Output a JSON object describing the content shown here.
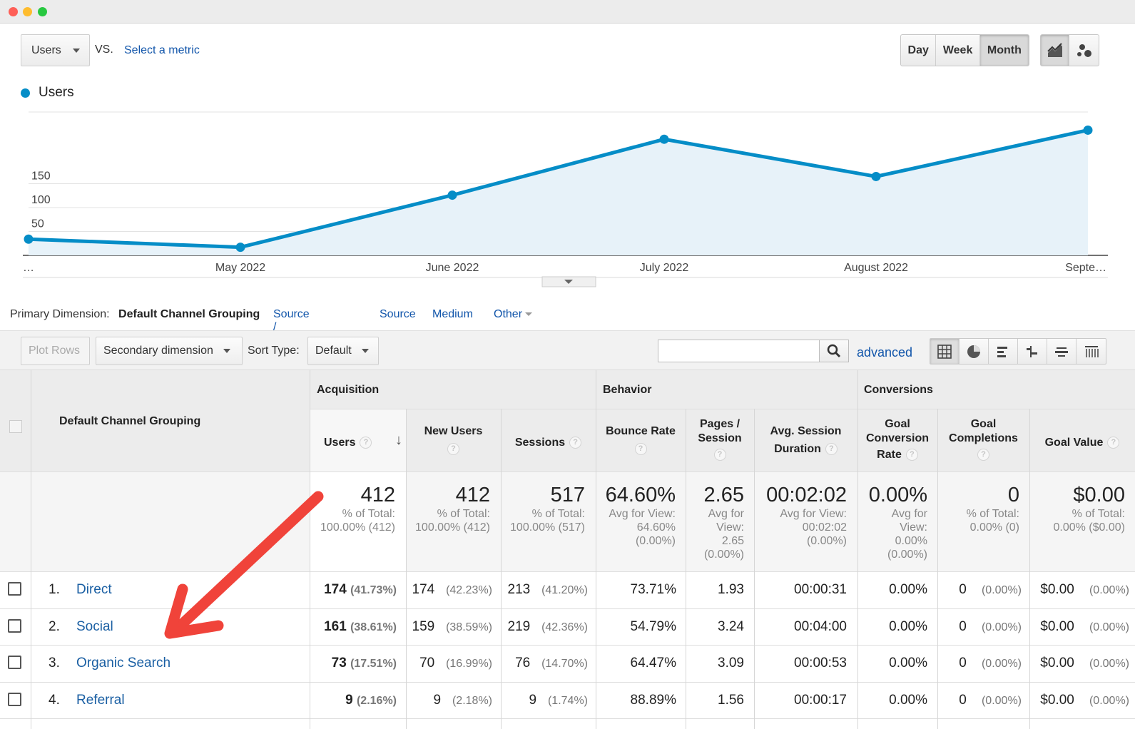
{
  "controls": {
    "metric_label": "Users",
    "vs_label": "VS.",
    "select_metric_label": "Select a metric",
    "period_buttons": [
      "Day",
      "Week",
      "Month"
    ],
    "active_period": "Month"
  },
  "chart_data": {
    "type": "area",
    "legend": "Users",
    "x_labels": [
      "…",
      "May 2022",
      "June 2022",
      "July 2022",
      "August 2022",
      "Septe…"
    ],
    "series": [
      {
        "name": "Users",
        "values": [
          34,
          17,
          126,
          243,
          165,
          262
        ]
      }
    ],
    "y_ticks": [
      50,
      100,
      150
    ],
    "ylim": [
      0,
      300
    ],
    "color": "#058dc7"
  },
  "dimension": {
    "label": "Primary Dimension:",
    "active": "Default Channel Grouping",
    "options": [
      "Source / Medium",
      "Source",
      "Medium",
      "Other"
    ]
  },
  "toolbar": {
    "plot_rows": "Plot Rows",
    "secondary_dimension": "Secondary dimension",
    "sort_type_label": "Sort Type:",
    "sort_type_value": "Default",
    "advanced": "advanced"
  },
  "table": {
    "dimension_header": "Default Channel Grouping",
    "groups": [
      "Acquisition",
      "Behavior",
      "Conversions"
    ],
    "columns": {
      "users": "Users",
      "new_users": "New Users",
      "sessions": "Sessions",
      "bounce_rate": "Bounce Rate",
      "pages_session_1": "Pages /",
      "pages_session_2": "Session",
      "avg_session_1": "Avg. Session",
      "avg_session_2": "Duration",
      "goal_conv_1": "Goal",
      "goal_conv_2": "Conversion",
      "goal_conv_3": "Rate",
      "goal_comp_1": "Goal",
      "goal_comp_2": "Completions",
      "goal_value": "Goal Value"
    },
    "totals": {
      "users": {
        "big": "412",
        "l1": "% of Total:",
        "l2": "100.00% (412)"
      },
      "new_users": {
        "big": "412",
        "l1": "% of Total:",
        "l2": "100.00% (412)"
      },
      "sessions": {
        "big": "517",
        "l1": "% of Total:",
        "l2": "100.00% (517)"
      },
      "bounce_rate": {
        "big": "64.60%",
        "l1": "Avg for View:",
        "l2": "64.60%",
        "l3": "(0.00%)"
      },
      "pages_session": {
        "big": "2.65",
        "l1": "Avg for",
        "l2": "View:",
        "l3": "2.65",
        "l4": "(0.00%)"
      },
      "avg_duration": {
        "big": "00:02:02",
        "l1": "Avg for View:",
        "l2": "00:02:02",
        "l3": "(0.00%)"
      },
      "goal_conv": {
        "big": "0.00%",
        "l1": "Avg for",
        "l2": "View:",
        "l3": "0.00%",
        "l4": "(0.00%)"
      },
      "goal_comp": {
        "big": "0",
        "l1": "% of Total:",
        "l2": "0.00% (0)"
      },
      "goal_value": {
        "big": "$0.00",
        "l1": "% of Total:",
        "l2": "0.00% ($0.00)"
      }
    },
    "rows": [
      {
        "num": "1.",
        "name": "Direct",
        "users": "174",
        "users_pct": "(41.73%)",
        "new_users": "174",
        "new_users_pct": "(42.23%)",
        "sessions": "213",
        "sessions_pct": "(41.20%)",
        "bounce": "73.71%",
        "pages": "1.93",
        "duration": "00:00:31",
        "conv": "0.00%",
        "comp": "0",
        "comp_pct": "(0.00%)",
        "value": "$0.00",
        "value_pct": "(0.00%)"
      },
      {
        "num": "2.",
        "name": "Social",
        "users": "161",
        "users_pct": "(38.61%)",
        "new_users": "159",
        "new_users_pct": "(38.59%)",
        "sessions": "219",
        "sessions_pct": "(42.36%)",
        "bounce": "54.79%",
        "pages": "3.24",
        "duration": "00:04:00",
        "conv": "0.00%",
        "comp": "0",
        "comp_pct": "(0.00%)",
        "value": "$0.00",
        "value_pct": "(0.00%)"
      },
      {
        "num": "3.",
        "name": "Organic Search",
        "users": "73",
        "users_pct": "(17.51%)",
        "new_users": "70",
        "new_users_pct": "(16.99%)",
        "sessions": "76",
        "sessions_pct": "(14.70%)",
        "bounce": "64.47%",
        "pages": "3.09",
        "duration": "00:00:53",
        "conv": "0.00%",
        "comp": "0",
        "comp_pct": "(0.00%)",
        "value": "$0.00",
        "value_pct": "(0.00%)"
      },
      {
        "num": "4.",
        "name": "Referral",
        "users": "9",
        "users_pct": "(2.16%)",
        "new_users": "9",
        "new_users_pct": "(2.18%)",
        "sessions": "9",
        "sessions_pct": "(1.74%)",
        "bounce": "88.89%",
        "pages": "1.56",
        "duration": "00:00:17",
        "conv": "0.00%",
        "comp": "0",
        "comp_pct": "(0.00%)",
        "value": "$0.00",
        "value_pct": "(0.00%)"
      }
    ]
  },
  "colors": {
    "accent": "#058dc7",
    "link": "#1155aa",
    "annotation_arrow": "#f0433a"
  }
}
